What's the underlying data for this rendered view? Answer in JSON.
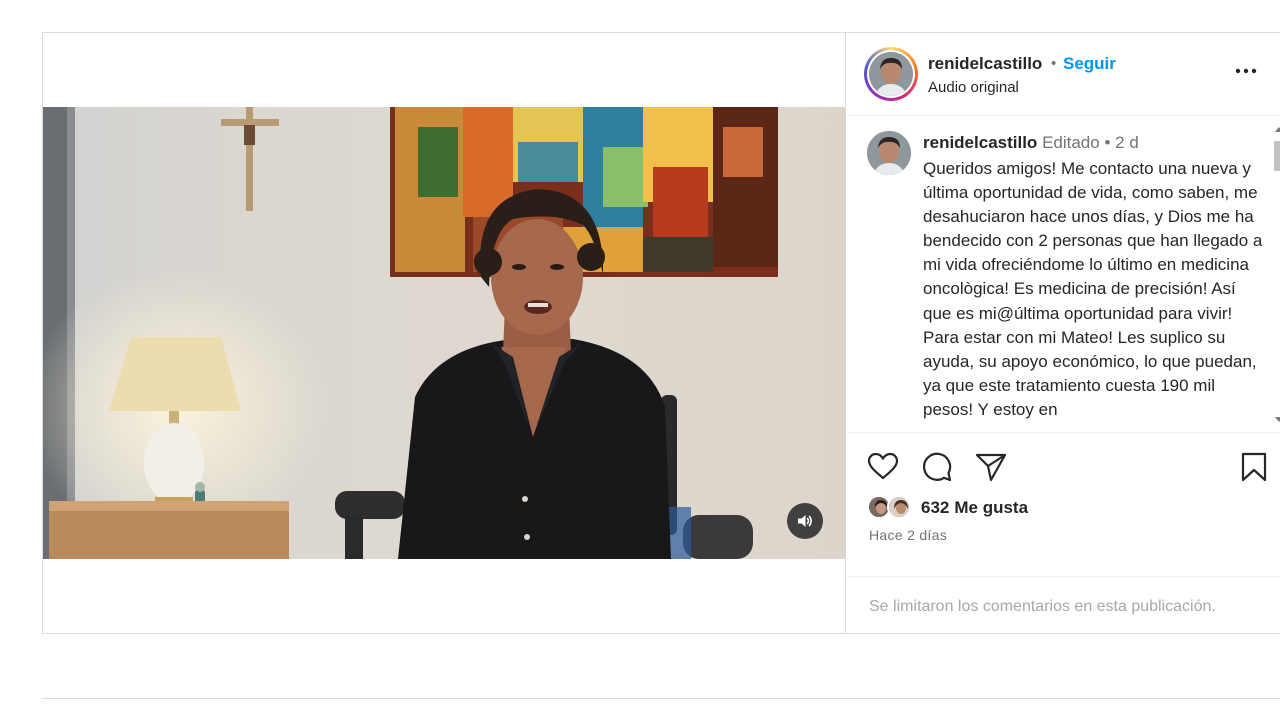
{
  "post": {
    "username": "renidelcastillo",
    "follow_label": "Seguir",
    "header_separator": "•",
    "audio_label": "Audio original",
    "more_icon": "more-horizontal-icon"
  },
  "caption": {
    "username": "renidelcastillo",
    "edited_label": "Editado",
    "meta_separator": "•",
    "time": "2 d",
    "text": "Queridos amigos! Me contacto una nueva y última oportunidad de vida, como saben, me desahuciaron hace unos días, y Dios me ha bendecido con 2 personas que han llegado a mi vida ofreciéndome lo último en medicina oncològica! Es medicina de precisión! Así que es mi@última oportunidad para vivir! Para estar con mi Mateo! Les suplico su ayuda, su apoyo económico, lo que puedan, ya que este tratamiento cuesta 190 mil pesos! Y estoy en"
  },
  "actions": {
    "like_icon": "heart-icon",
    "comment_icon": "comment-icon",
    "share_icon": "share-icon",
    "save_icon": "bookmark-icon"
  },
  "likes": {
    "count": "632",
    "label": "Me gusta"
  },
  "time_ago": "Hace 2 días",
  "comments_notice": "Se limitaron los comentarios en esta publicación.",
  "video": {
    "mute_icon": "speaker-icon"
  },
  "colors": {
    "follow": "#0095f6",
    "text": "#262626",
    "secondary": "#737373",
    "muted": "#a8a8a8",
    "border": "#dbdbdb"
  }
}
